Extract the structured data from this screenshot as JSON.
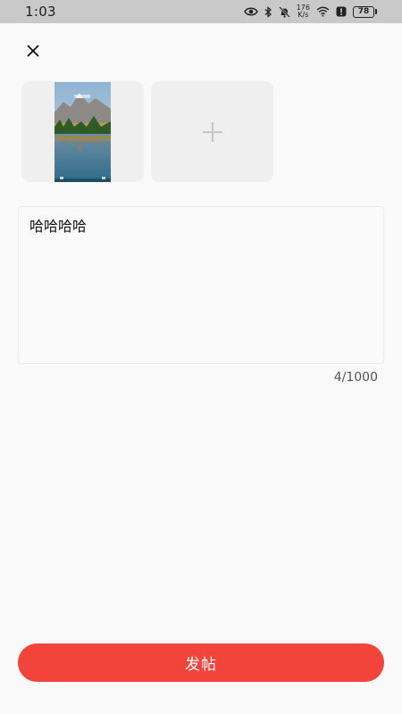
{
  "status_bar": {
    "time": "1:03",
    "net_speed_value": "176",
    "net_speed_unit": "K/s",
    "battery": "78",
    "icons": [
      "eye-icon",
      "bluetooth-icon",
      "bell-off-icon",
      "wifi-icon",
      "alert-icon",
      "battery-icon"
    ]
  },
  "close_icon": "close-icon",
  "photos": {
    "add_icon": "plus-icon"
  },
  "post": {
    "text": "哈哈哈哈",
    "counter": "4/1000"
  },
  "submit": {
    "label": "发帖"
  },
  "colors": {
    "accent": "#f2443a",
    "status_bar": "#c9c9c9",
    "background": "#f9f9f9"
  }
}
